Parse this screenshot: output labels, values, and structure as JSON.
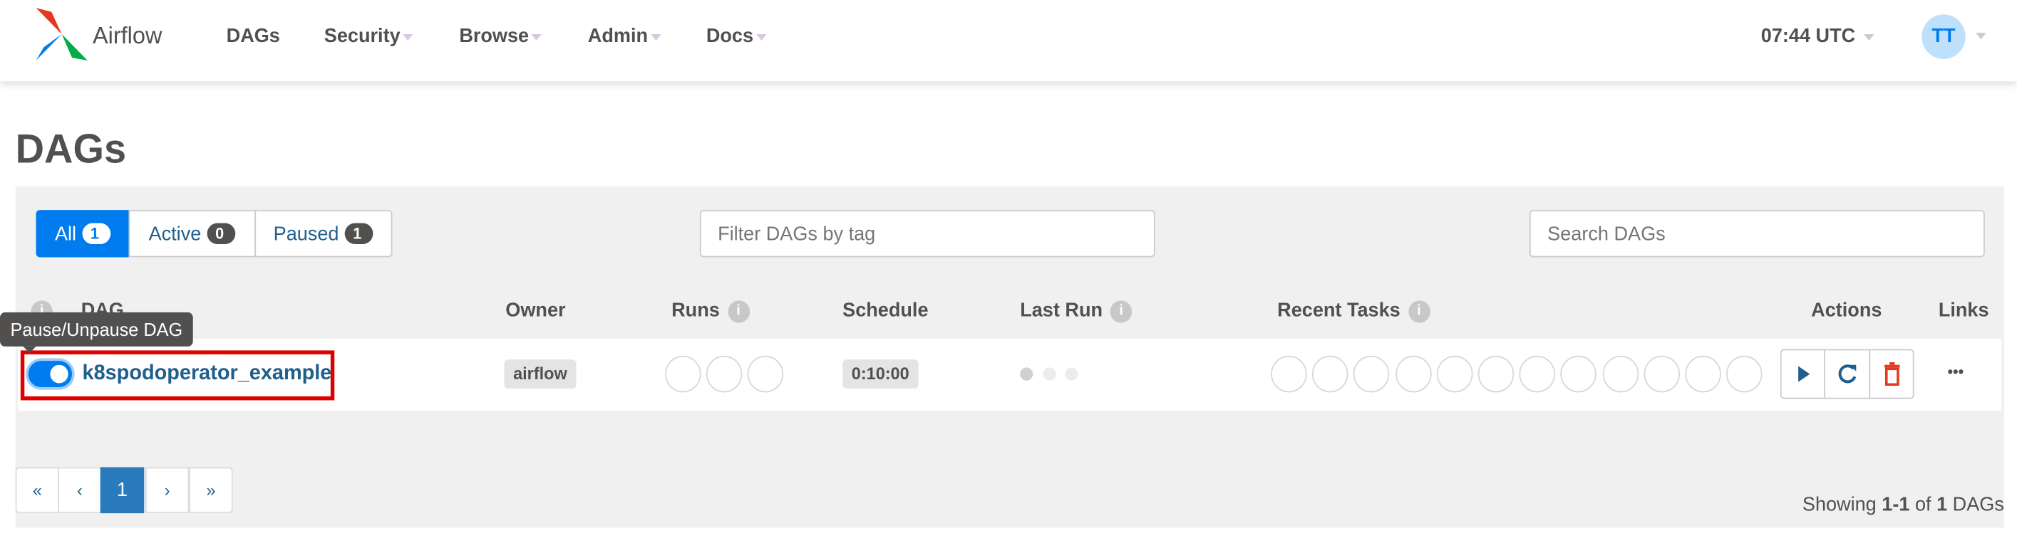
{
  "nav": {
    "brand": "Airflow",
    "items": [
      {
        "label": "DAGs",
        "dropdown": false
      },
      {
        "label": "Security",
        "dropdown": true
      },
      {
        "label": "Browse",
        "dropdown": true
      },
      {
        "label": "Admin",
        "dropdown": true
      },
      {
        "label": "Docs",
        "dropdown": true
      }
    ],
    "time": "07:44 UTC",
    "user_initials": "TT"
  },
  "page": {
    "title": "DAGs"
  },
  "filters": {
    "all": {
      "label": "All",
      "count": "1"
    },
    "active": {
      "label": "Active",
      "count": "0"
    },
    "paused": {
      "label": "Paused",
      "count": "1"
    },
    "tag_placeholder": "Filter DAGs by tag",
    "search_placeholder": "Search DAGs"
  },
  "table": {
    "headers": {
      "dag": "DAG",
      "owner": "Owner",
      "runs": "Runs",
      "schedule": "Schedule",
      "last_run": "Last Run",
      "recent_tasks": "Recent Tasks",
      "actions": "Actions",
      "links": "Links"
    },
    "rows": [
      {
        "dag_id": "k8spodoperator_example",
        "paused": false,
        "owner": "airflow",
        "schedule": "0:10:00",
        "links": "•••"
      }
    ]
  },
  "tooltip": "Pause/Unpause DAG",
  "pagination": {
    "first": "«",
    "prev": "‹",
    "current": "1",
    "next": "›",
    "last": "»"
  },
  "summary": {
    "prefix": "Showing ",
    "range": "1-1",
    "mid": " of ",
    "total": "1",
    "suffix": " DAGs"
  },
  "colors": {
    "accent": "#017cee",
    "link": "#1f5f8b",
    "highlight_box": "#e00000",
    "delete": "#e43921"
  }
}
